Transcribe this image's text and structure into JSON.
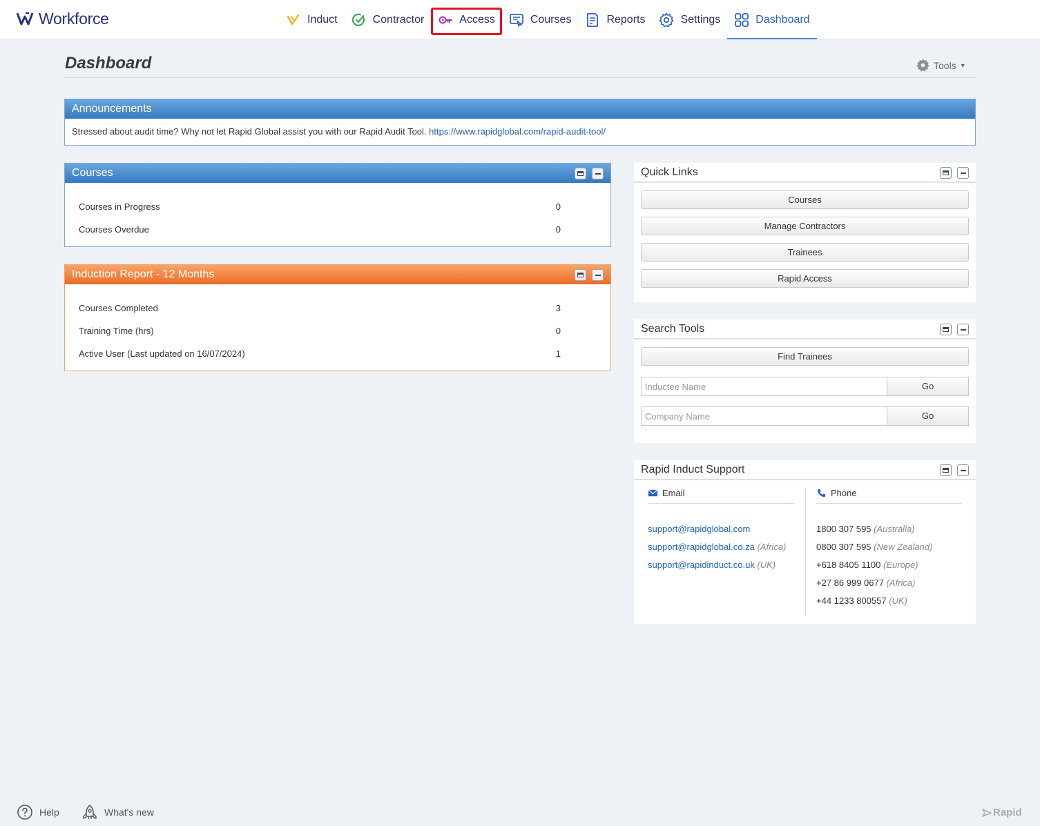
{
  "app": {
    "logo_text": "Workforce"
  },
  "nav": {
    "items": [
      {
        "label": "Induct",
        "icon": "induct-icon"
      },
      {
        "label": "Contractor",
        "icon": "contractor-check-icon"
      },
      {
        "label": "Access",
        "icon": "access-key-icon"
      },
      {
        "label": "Courses",
        "icon": "courses-icon"
      },
      {
        "label": "Reports",
        "icon": "reports-icon"
      },
      {
        "label": "Settings",
        "icon": "gear-icon"
      },
      {
        "label": "Dashboard",
        "icon": "dashboard-grid-icon"
      }
    ],
    "active": "Dashboard",
    "highlighted": "Access"
  },
  "page": {
    "title": "Dashboard",
    "tools_label": "Tools"
  },
  "announcements": {
    "title": "Announcements",
    "text": "Stressed about audit time? Why not let Rapid Global assist you with our Rapid Audit Tool.",
    "link": "https://www.rapidglobal.com/rapid-audit-tool/"
  },
  "courses_panel": {
    "title": "Courses",
    "rows": [
      {
        "label": "Courses in Progress",
        "value": "0"
      },
      {
        "label": "Courses Overdue",
        "value": "0"
      }
    ]
  },
  "induction_panel": {
    "title": "Induction Report - 12 Months",
    "rows": [
      {
        "label": "Courses Completed",
        "value": "3"
      },
      {
        "label": "Training Time (hrs)",
        "value": "0"
      },
      {
        "label": "Active User (Last updated on 16/07/2024)",
        "value": "1"
      }
    ]
  },
  "quick_links": {
    "title": "Quick Links",
    "buttons": [
      "Courses",
      "Manage Contractors",
      "Trainees",
      "Rapid Access"
    ]
  },
  "search_tools": {
    "title": "Search Tools",
    "find_trainees": "Find Trainees",
    "inductee_placeholder": "Inductee Name",
    "company_placeholder": "Company Name",
    "go_label": "Go"
  },
  "support": {
    "title": "Rapid Induct Support",
    "email_heading": "Email",
    "phone_heading": "Phone",
    "emails": [
      {
        "address": "support@rapidglobal.com",
        "region": ""
      },
      {
        "address": "support@rapidglobal.co.za",
        "region": "(Africa)"
      },
      {
        "address": "support@rapidinduct.co.uk",
        "region": "(UK)"
      }
    ],
    "phones": [
      {
        "number": "1800 307 595",
        "region": "(Australia)"
      },
      {
        "number": "0800 307 595",
        "region": "(New Zealand)"
      },
      {
        "number": "+618 8405 1100",
        "region": "(Europe)"
      },
      {
        "number": "+27 86 999 0677",
        "region": "(Africa)"
      },
      {
        "number": "+44 1233 800557",
        "region": "(UK)"
      }
    ]
  },
  "footer": {
    "help": "Help",
    "whats_new": "What's new",
    "brand": "Rapid"
  },
  "colors": {
    "accent": "#2a62c9",
    "highlight_box": "#e0141e",
    "blue_header": "#3479c0",
    "orange_header": "#ec6a26"
  }
}
